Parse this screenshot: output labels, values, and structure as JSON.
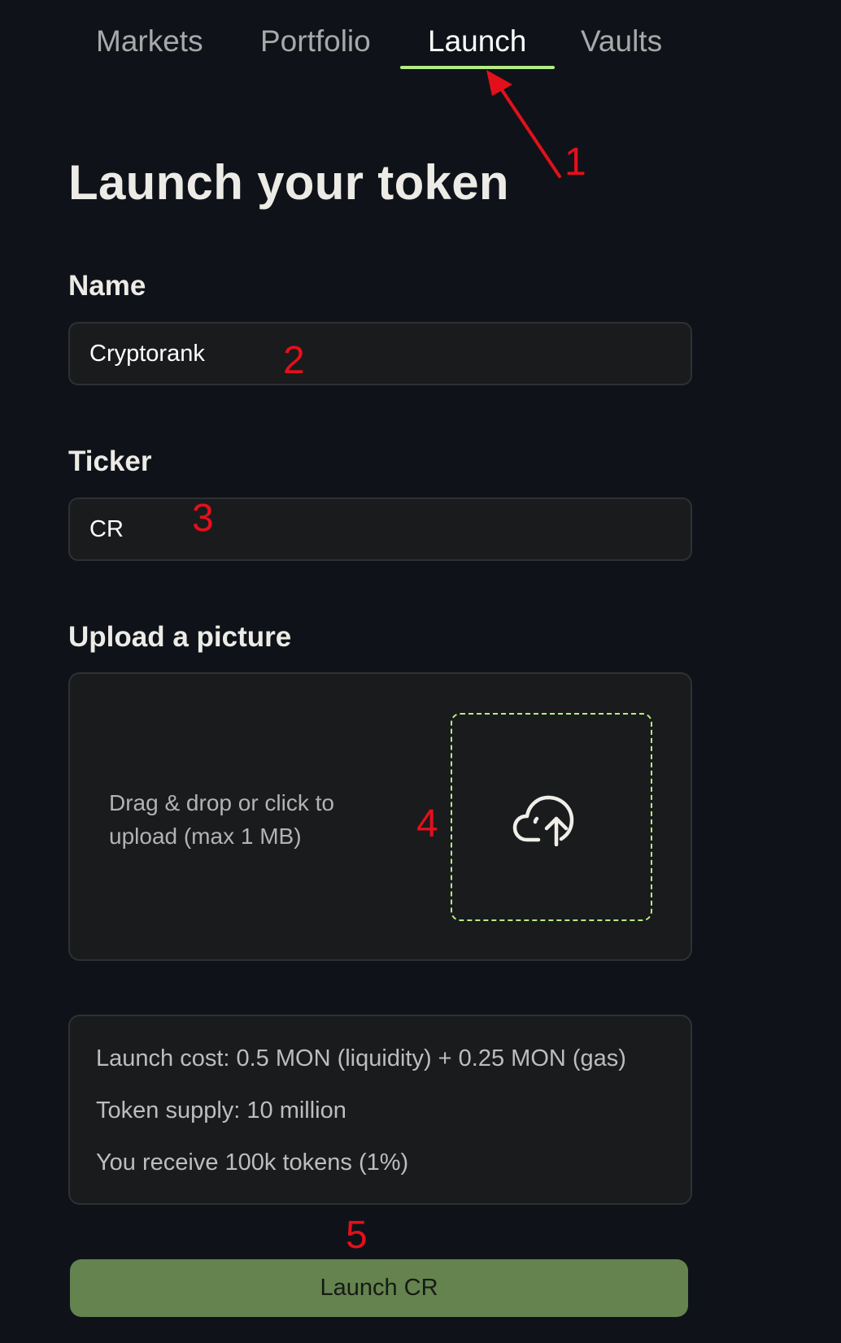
{
  "nav": {
    "tabs": [
      {
        "label": "Markets",
        "active": false
      },
      {
        "label": "Portfolio",
        "active": false
      },
      {
        "label": "Launch",
        "active": true
      },
      {
        "label": "Vaults",
        "active": false
      }
    ],
    "active_underline_color": "#b2ec83"
  },
  "page": {
    "title": "Launch your token"
  },
  "form": {
    "name": {
      "label": "Name",
      "value": "Cryptorank"
    },
    "ticker": {
      "label": "Ticker",
      "value": "CR"
    },
    "upload": {
      "label": "Upload a picture",
      "hint": "Drag & drop or click to upload (max 1 MB)",
      "icon": "cloud-upload-icon"
    }
  },
  "info": {
    "lines": [
      "Launch cost: 0.5 MON (liquidity) + 0.25 MON (gas)",
      "Token supply: 10 million",
      "You receive 100k tokens (1%)"
    ]
  },
  "launch_button": {
    "label": "Launch CR",
    "color": "#64834f"
  },
  "annotations": {
    "color": "#e3101b",
    "numbers": [
      "1",
      "2",
      "3",
      "4",
      "5"
    ]
  }
}
